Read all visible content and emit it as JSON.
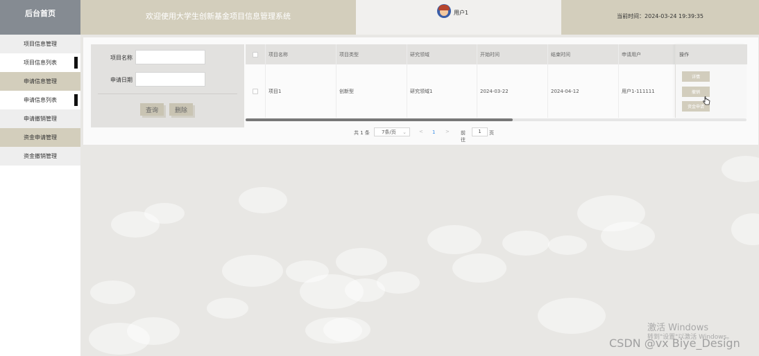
{
  "header": {
    "logo": "后台首页",
    "title": "欢迎使用大学生创新基金项目信息管理系统",
    "username": "用户1",
    "current_time": "当前时间：2024-03-24 19:39:35"
  },
  "sidebar": {
    "items": [
      {
        "label": "项目信息管理"
      },
      {
        "label": "项目信息列表"
      },
      {
        "label": "申请信息管理"
      },
      {
        "label": "申请信息列表"
      },
      {
        "label": "申请撤销管理"
      },
      {
        "label": "资金申请管理"
      },
      {
        "label": "资金撤销管理"
      }
    ]
  },
  "search": {
    "project_name_label": "项目名称",
    "project_name_value": "",
    "apply_date_label": "申请日期",
    "apply_date_value": "",
    "query_button": "查询",
    "delete_button": "删除"
  },
  "table": {
    "columns": [
      "项目名称",
      "项目类型",
      "研究领域",
      "开始时间",
      "结束时间",
      "申请用户",
      "操作"
    ],
    "rows": [
      {
        "name": "项目1",
        "type": "创新型",
        "field": "研究领域1",
        "start": "2024-03-22",
        "end": "2024-04-12",
        "user": "用户1-111111"
      }
    ],
    "actions": [
      "详情",
      "撤销",
      "资金申请"
    ]
  },
  "pagination": {
    "total": "共 1 条",
    "page_size": "7条/页",
    "prev": "<",
    "current_page": "1",
    "next": ">",
    "goto_label": "前往",
    "goto_value": "1",
    "goto_unit": "页"
  },
  "watermark": {
    "activate_title": "激活 Windows",
    "activate_sub": "转到\"设置\"以激活 Windows。",
    "csdn": "CSDN @vx Biye_Design"
  }
}
